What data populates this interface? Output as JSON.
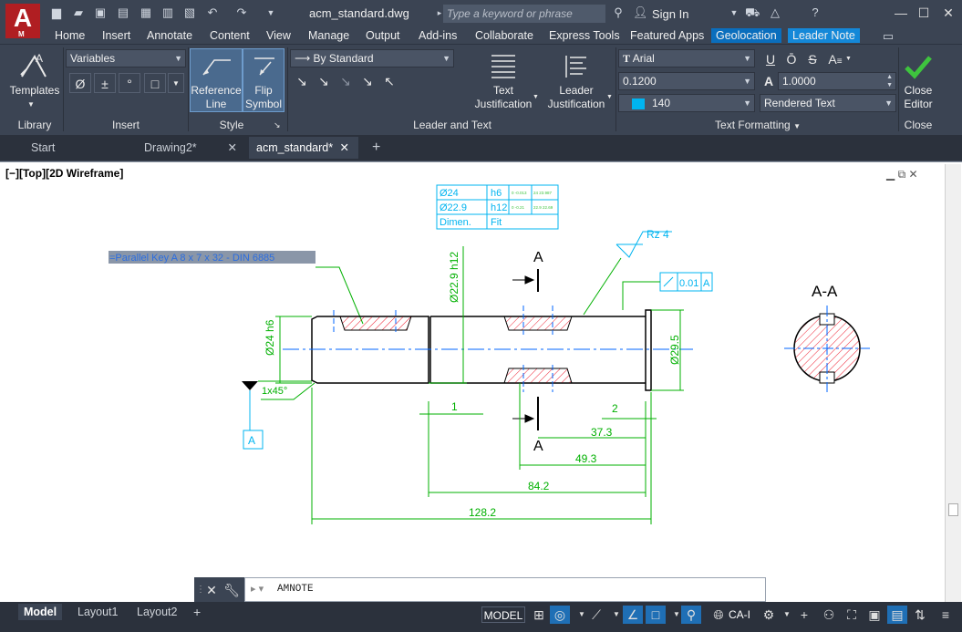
{
  "app": {
    "logo_letter": "A",
    "logo_sub": "M",
    "title": "acm_standard.dwg"
  },
  "search": {
    "placeholder": "Type a keyword or phrase"
  },
  "account": {
    "sign_in": "Sign In"
  },
  "menu_tabs": [
    "Home",
    "Insert",
    "Annotate",
    "Content",
    "View",
    "Manage",
    "Output",
    "Add-ins",
    "Collaborate",
    "Express Tools",
    "Featured Apps",
    "Geolocation",
    "Leader Note"
  ],
  "ribbon": {
    "library": {
      "templates_label": "Templates",
      "panel": "Library"
    },
    "insert": {
      "variables": "Variables",
      "panel": "Insert",
      "symbols": [
        "Ø",
        "±",
        "°"
      ]
    },
    "style": {
      "reference_line": [
        "Reference",
        "Line"
      ],
      "flip_symbol": [
        "Flip",
        "Symbol"
      ],
      "panel": "Style"
    },
    "leader_text": {
      "standard": "By Standard",
      "panel": "Leader and Text",
      "text_just": [
        "Text",
        "Justification"
      ],
      "leader_just": [
        "Leader",
        "Justification"
      ]
    },
    "text_formatting": {
      "font": "Arial",
      "height": "0.1200",
      "color_index": "140",
      "width_factor": "1.0000",
      "rendering": "Rendered Text",
      "panel": "Text Formatting",
      "u": "U",
      "o": "Ō",
      "s": "S",
      "a": "A"
    },
    "close": {
      "label": [
        "Close",
        "Editor"
      ],
      "panel": "Close"
    }
  },
  "doc_tabs": [
    "Start",
    "Drawing2*",
    "acm_standard*"
  ],
  "viewport_label": "[−][Top][2D Wireframe]",
  "drawing": {
    "fit_table": [
      [
        "Ø24",
        "h6",
        "0\n-0.013",
        "24\n23.987"
      ],
      [
        "Ø22.9",
        "h12",
        "0\n-0.21",
        "22.9\n22.69"
      ],
      [
        "Dimen.",
        "Fit",
        "",
        ""
      ]
    ],
    "leader_note": "=Parallel Key  A 8 x 7 x 32 - DIN 6885",
    "roughness": "Rz 4",
    "tolerance": "0.01",
    "datum": "A",
    "section_mark": "A",
    "section_title": "A-A",
    "chamfer": "1x45°",
    "dims": {
      "d24": "Ø24 h6",
      "d229": "Ø22.9 h12",
      "d295": "Ø29.5",
      "one": "1",
      "two": "2",
      "d373": "37.3",
      "d493": "49.3",
      "d842": "84.2",
      "d1282": "128.2"
    }
  },
  "command": {
    "text": "AMNOTE"
  },
  "layout_tabs": [
    "Model",
    "Layout1",
    "Layout2"
  ],
  "status": {
    "model": "MODEL",
    "ci": "CA-I"
  }
}
